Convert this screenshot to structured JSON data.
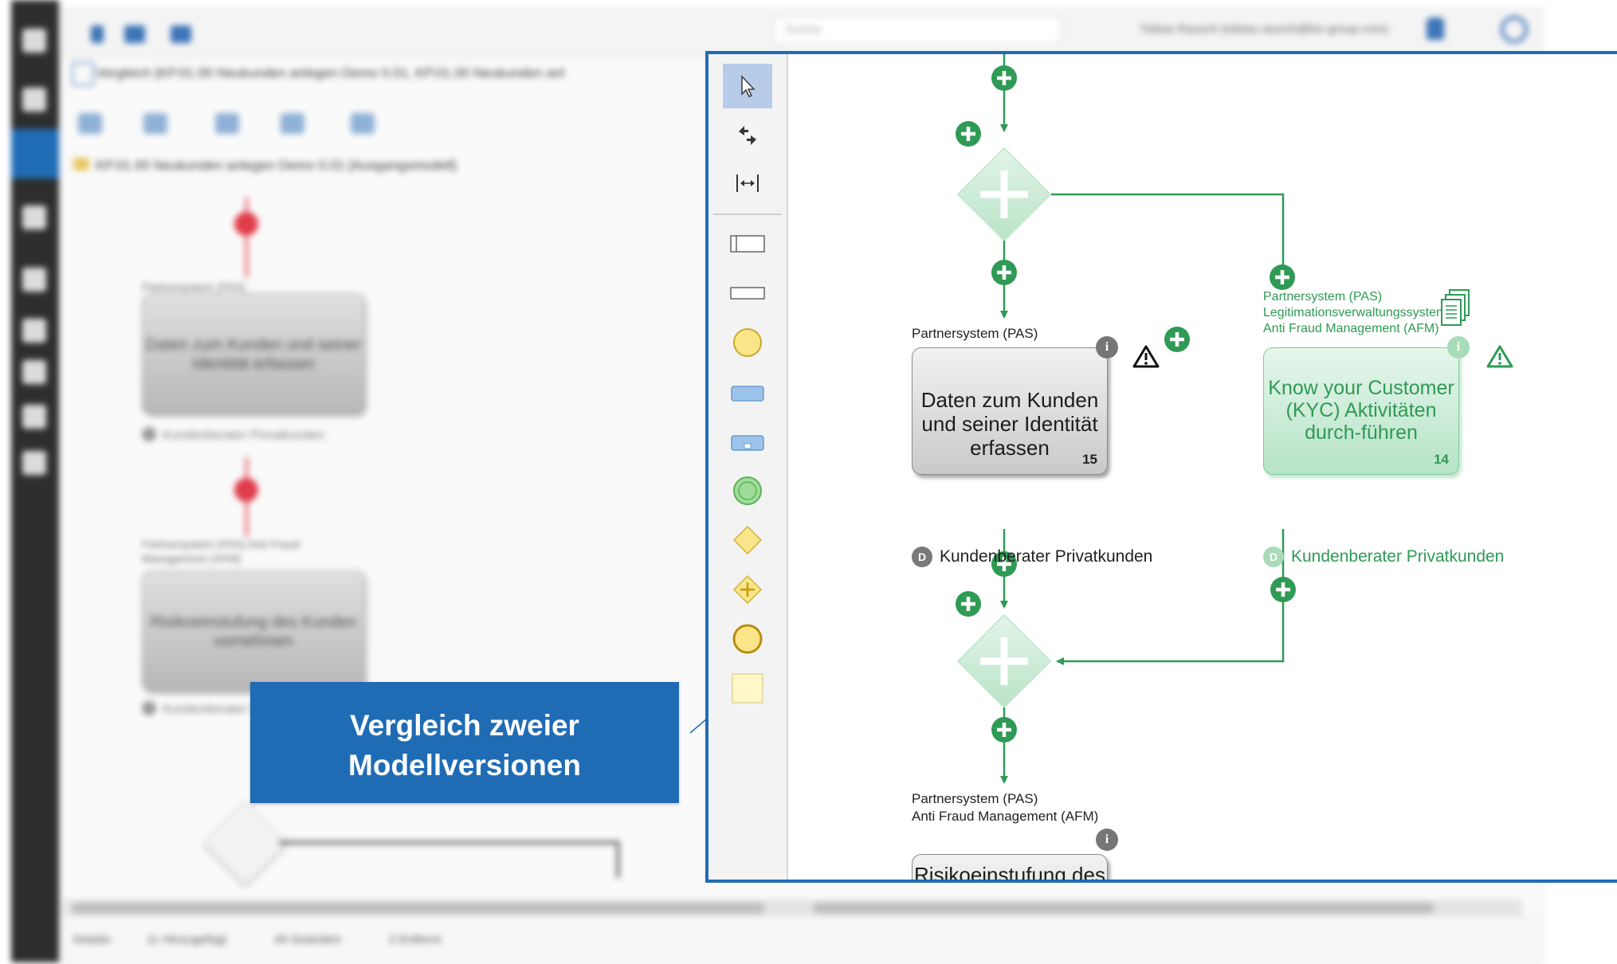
{
  "app": {
    "search_placeholder": "Suche",
    "user_line": "Tobias Rausch (tobias.rausch@bic-group.com)",
    "document_title": "Vergleich [KP.01.00 Neukunden anlegen Demo 0.01, KP.01.00 Neukunden anl",
    "model_title": "KP.01.00 Neukunden anlegen Demo 0.01 [Ausgangsmodell]",
    "status_details": "Details:",
    "status_added": "11 Hinzugefügt",
    "status_changed": "26 Geändert",
    "status_removed": "2 Entfernt",
    "colors": {
      "accent": "#1f6cb5",
      "added": "#2f9a55",
      "removed": "#e03c4a"
    }
  },
  "background_model": {
    "task1_lane": "Partnersystem (PAS)",
    "task1_label": "Daten zum Kunden und seiner Identität erfassen",
    "task1_role": "Kundenberater Privatkunden",
    "task2_lane": "Partnersystem (PAS) Anti Fraud Management (AFM)",
    "task2_label": "Risikoeinstufung des Kunden vornehmen",
    "task2_role": "Kundenberater Privatkunden"
  },
  "comparison": {
    "lane_pas": "Partnersystem (PAS)",
    "task_main": {
      "label": "Daten zum Kunden und seiner Identität erfassen",
      "number": "15",
      "role_badge": "D",
      "role": "Kundenberater Privatkunden"
    },
    "task_kyc": {
      "lane_lines": [
        "Partnersystem (PAS)",
        "Legitimationsverwaltungssystem,",
        "Anti Fraud Management (AFM)"
      ],
      "label": "Know your Customer (KYC) Aktivitäten durch-führen",
      "number": "14",
      "role_badge": "D",
      "role": "Kundenberater Privatkunden"
    },
    "task_bottom": {
      "lane_lines": [
        "Partnersystem (PAS)",
        "Anti Fraud Management (AFM)"
      ],
      "label": "Risikoeinstufung des"
    }
  },
  "callout": {
    "line1": "Vergleich zweier",
    "line2": "Modellversionen"
  }
}
